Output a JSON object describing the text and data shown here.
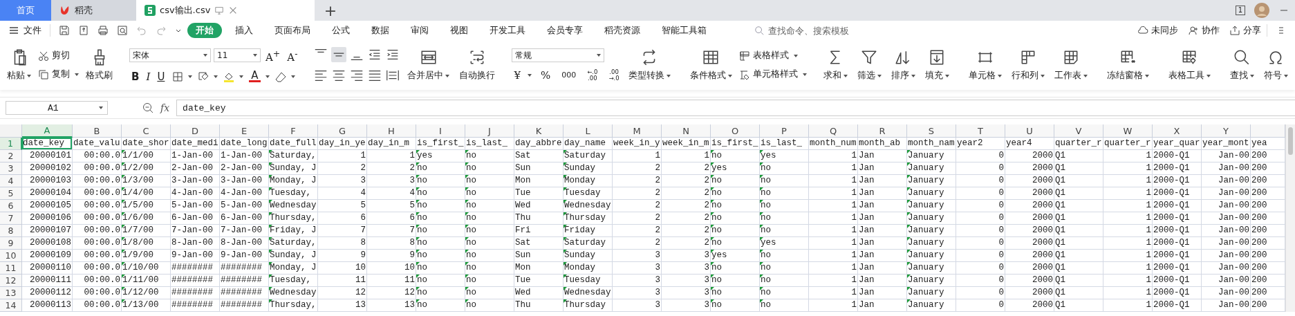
{
  "tabs": [
    {
      "label": "首页",
      "kind": "home",
      "selected": false
    },
    {
      "label": "稻壳",
      "kind": "docer",
      "selected": false
    },
    {
      "label": "csv输出.csv",
      "kind": "sheet",
      "selected": true
    }
  ],
  "new_tab": "+",
  "window_count": "1",
  "file_menu": "文件",
  "menu_tabs": [
    {
      "label": "开始",
      "selected": true
    },
    {
      "label": "插入",
      "selected": false
    },
    {
      "label": "页面布局",
      "selected": false
    },
    {
      "label": "公式",
      "selected": false
    },
    {
      "label": "数据",
      "selected": false
    },
    {
      "label": "审阅",
      "selected": false
    },
    {
      "label": "视图",
      "selected": false
    },
    {
      "label": "开发工具",
      "selected": false
    },
    {
      "label": "会员专享",
      "selected": false
    },
    {
      "label": "稻壳资源",
      "selected": false
    },
    {
      "label": "智能工具箱",
      "selected": false
    }
  ],
  "search": {
    "placeholder": "查找命令、搜索模板"
  },
  "actions": [
    "未同步",
    "协作",
    "分享"
  ],
  "ribbon": {
    "paste": {
      "label": "粘贴",
      "dropdown": true
    },
    "cut": {
      "label": "剪切",
      "dropdown": false
    },
    "copy": {
      "label": "复制",
      "dropdown": true
    },
    "format_painter": {
      "label": "格式刷",
      "dropdown": false
    },
    "font": {
      "name": "宋体",
      "size": "11",
      "grow": "A$^{+}$",
      "shrink": "A$^{-}$",
      "bold": "B",
      "italic": "I",
      "underline": "U",
      "font_color_label": "A"
    },
    "align_buttons": [
      {
        "selected": false
      },
      {
        "selected": true
      },
      {
        "selected": false
      },
      {
        "selected": false
      },
      {
        "selected": false
      },
      {
        "selected": false
      },
      {
        "selected": false
      },
      {
        "selected": false
      },
      {
        "selected": false
      },
      {
        "selected": false
      }
    ],
    "merge": {
      "label": "合并居中",
      "dropdown": true
    },
    "wrap": {
      "label": "自动换行",
      "dropdown": false
    },
    "number": {
      "format": "常规",
      "currency": "¥",
      "percent": "%",
      "thousands": "000",
      "increase_decimal": [
        "←.0",
        ".00"
      ],
      "decrease_decimal": [
        ".00",
        "→.0"
      ]
    },
    "convert": {
      "label": "类型转换",
      "dropdown": true
    },
    "conditional": {
      "label": "条件格式",
      "dropdown": true
    },
    "table_style": {
      "label": "表格样式",
      "dropdown": true
    },
    "cell_style": {
      "label": "单元格样式",
      "dropdown": true
    },
    "tool_groups": [
      [
        {
          "label": "求和",
          "dropdown": true
        },
        {
          "label": "筛选",
          "dropdown": true
        },
        {
          "label": "排序",
          "dropdown": true
        },
        {
          "label": "填充",
          "dropdown": true
        }
      ],
      [
        {
          "label": "单元格",
          "dropdown": true
        },
        {
          "label": "行和列",
          "dropdown": true
        },
        {
          "label": "工作表",
          "dropdown": true
        }
      ],
      [
        {
          "label": "冻结窗格",
          "dropdown": true
        }
      ],
      [
        {
          "label": "表格工具",
          "dropdown": true
        }
      ],
      [
        {
          "label": "查找",
          "dropdown": true
        },
        {
          "label": "符号",
          "dropdown": true
        }
      ]
    ]
  },
  "formula_bar": {
    "name_box": "A1",
    "fx": "fx",
    "formula": "date_key"
  },
  "grid": {
    "columns": [
      {
        "letter": "A",
        "numeric": true,
        "flagged": false,
        "selected": true
      },
      {
        "letter": "B",
        "numeric": true,
        "flagged": false,
        "selected": false
      },
      {
        "letter": "C",
        "numeric": false,
        "flagged": true,
        "selected": false
      },
      {
        "letter": "D",
        "numeric": false,
        "flagged": false,
        "selected": false
      },
      {
        "letter": "E",
        "numeric": false,
        "flagged": false,
        "selected": false
      },
      {
        "letter": "F",
        "numeric": false,
        "flagged": true,
        "selected": false
      },
      {
        "letter": "G",
        "numeric": true,
        "flagged": false,
        "selected": false
      },
      {
        "letter": "H",
        "numeric": true,
        "flagged": false,
        "selected": false
      },
      {
        "letter": "I",
        "numeric": false,
        "flagged": true,
        "selected": false
      },
      {
        "letter": "J",
        "numeric": false,
        "flagged": true,
        "selected": false
      },
      {
        "letter": "K",
        "numeric": false,
        "flagged": false,
        "selected": false
      },
      {
        "letter": "L",
        "numeric": false,
        "flagged": true,
        "selected": false
      },
      {
        "letter": "M",
        "numeric": true,
        "flagged": false,
        "selected": false
      },
      {
        "letter": "N",
        "numeric": true,
        "flagged": false,
        "selected": false
      },
      {
        "letter": "O",
        "numeric": false,
        "flagged": true,
        "selected": false
      },
      {
        "letter": "P",
        "numeric": false,
        "flagged": true,
        "selected": false
      },
      {
        "letter": "Q",
        "numeric": true,
        "flagged": false,
        "selected": false
      },
      {
        "letter": "R",
        "numeric": false,
        "flagged": false,
        "selected": false
      },
      {
        "letter": "S",
        "numeric": false,
        "flagged": true,
        "selected": false
      },
      {
        "letter": "T",
        "numeric": true,
        "flagged": false,
        "selected": false
      },
      {
        "letter": "U",
        "numeric": true,
        "flagged": false,
        "selected": false
      },
      {
        "letter": "V",
        "numeric": false,
        "flagged": false,
        "selected": false
      },
      {
        "letter": "W",
        "numeric": true,
        "flagged": false,
        "selected": false
      },
      {
        "letter": "X",
        "numeric": false,
        "flagged": false,
        "selected": false
      },
      {
        "letter": "Y",
        "numeric": true,
        "flagged": false,
        "selected": false
      },
      {
        "numeric": false,
        "flagged": false,
        "selected": false
      }
    ],
    "rows": [
      {
        "number": "1",
        "kind": "header",
        "selected": true,
        "cells": [
          "date_key",
          "date_valu",
          "date_shor",
          "date_medi",
          "date_long",
          "date_full",
          "day_in_ye",
          "day_in_m",
          "is_first_",
          "is_last_",
          "day_abbre",
          "day_name",
          "week_in_y",
          "week_in_m",
          "is_first_",
          "is_last_",
          "month_num",
          "month_ab",
          "month_nam",
          "year2",
          "year4",
          "quarter_r",
          "quarter_r",
          "year_quar",
          "year_mont",
          "yea"
        ]
      },
      {
        "number": "2",
        "kind": "data",
        "selected": false,
        "cells": [
          "20000101",
          "00:00.0",
          "1/1/00",
          "1-Jan-00",
          "1-Jan-00",
          "Saturday,",
          "1",
          "1",
          "yes",
          "no",
          "Sat",
          "Saturday",
          "1",
          "1",
          "no",
          "yes",
          "1",
          "Jan",
          "January",
          "0",
          "2000",
          "Q1",
          "1",
          "2000-Q1",
          "Jan-00",
          "200"
        ]
      },
      {
        "number": "3",
        "kind": "data",
        "selected": false,
        "cells": [
          "20000102",
          "00:00.0",
          "1/2/00",
          "2-Jan-00",
          "2-Jan-00",
          "Sunday, J",
          "2",
          "2",
          "no",
          "no",
          "Sun",
          "Sunday",
          "2",
          "2",
          "yes",
          "no",
          "1",
          "Jan",
          "January",
          "0",
          "2000",
          "Q1",
          "1",
          "2000-Q1",
          "Jan-00",
          "200"
        ]
      },
      {
        "number": "4",
        "kind": "data",
        "selected": false,
        "cells": [
          "20000103",
          "00:00.0",
          "1/3/00",
          "3-Jan-00",
          "3-Jan-00",
          "Monday, J",
          "3",
          "3",
          "no",
          "no",
          "Mon",
          "Monday",
          "2",
          "2",
          "no",
          "no",
          "1",
          "Jan",
          "January",
          "0",
          "2000",
          "Q1",
          "1",
          "2000-Q1",
          "Jan-00",
          "200"
        ]
      },
      {
        "number": "5",
        "kind": "data",
        "selected": false,
        "cells": [
          "20000104",
          "00:00.0",
          "1/4/00",
          "4-Jan-00",
          "4-Jan-00",
          "Tuesday,",
          "4",
          "4",
          "no",
          "no",
          "Tue",
          "Tuesday",
          "2",
          "2",
          "no",
          "no",
          "1",
          "Jan",
          "January",
          "0",
          "2000",
          "Q1",
          "1",
          "2000-Q1",
          "Jan-00",
          "200"
        ]
      },
      {
        "number": "6",
        "kind": "data",
        "selected": false,
        "cells": [
          "20000105",
          "00:00.0",
          "1/5/00",
          "5-Jan-00",
          "5-Jan-00",
          "Wednesday",
          "5",
          "5",
          "no",
          "no",
          "Wed",
          "Wednesday",
          "2",
          "2",
          "no",
          "no",
          "1",
          "Jan",
          "January",
          "0",
          "2000",
          "Q1",
          "1",
          "2000-Q1",
          "Jan-00",
          "200"
        ]
      },
      {
        "number": "7",
        "kind": "data",
        "selected": false,
        "cells": [
          "20000106",
          "00:00.0",
          "1/6/00",
          "6-Jan-00",
          "6-Jan-00",
          "Thursday,",
          "6",
          "6",
          "no",
          "no",
          "Thu",
          "Thursday",
          "2",
          "2",
          "no",
          "no",
          "1",
          "Jan",
          "January",
          "0",
          "2000",
          "Q1",
          "1",
          "2000-Q1",
          "Jan-00",
          "200"
        ]
      },
      {
        "number": "8",
        "kind": "data",
        "selected": false,
        "cells": [
          "20000107",
          "00:00.0",
          "1/7/00",
          "7-Jan-00",
          "7-Jan-00",
          "Friday, J",
          "7",
          "7",
          "no",
          "no",
          "Fri",
          "Friday",
          "2",
          "2",
          "no",
          "no",
          "1",
          "Jan",
          "January",
          "0",
          "2000",
          "Q1",
          "1",
          "2000-Q1",
          "Jan-00",
          "200"
        ]
      },
      {
        "number": "9",
        "kind": "data",
        "selected": false,
        "cells": [
          "20000108",
          "00:00.0",
          "1/8/00",
          "8-Jan-00",
          "8-Jan-00",
          "Saturday,",
          "8",
          "8",
          "no",
          "no",
          "Sat",
          "Saturday",
          "2",
          "2",
          "no",
          "yes",
          "1",
          "Jan",
          "January",
          "0",
          "2000",
          "Q1",
          "1",
          "2000-Q1",
          "Jan-00",
          "200"
        ]
      },
      {
        "number": "10",
        "kind": "data",
        "selected": false,
        "cells": [
          "20000109",
          "00:00.0",
          "1/9/00",
          "9-Jan-00",
          "9-Jan-00",
          "Sunday, J",
          "9",
          "9",
          "no",
          "no",
          "Sun",
          "Sunday",
          "3",
          "3",
          "yes",
          "no",
          "1",
          "Jan",
          "January",
          "0",
          "2000",
          "Q1",
          "1",
          "2000-Q1",
          "Jan-00",
          "200"
        ]
      },
      {
        "number": "11",
        "kind": "data",
        "selected": false,
        "cells": [
          "20000110",
          "00:00.0",
          "1/10/00",
          "########",
          "########",
          "Monday, J",
          "10",
          "10",
          "no",
          "no",
          "Mon",
          "Monday",
          "3",
          "3",
          "no",
          "no",
          "1",
          "Jan",
          "January",
          "0",
          "2000",
          "Q1",
          "1",
          "2000-Q1",
          "Jan-00",
          "200"
        ]
      },
      {
        "number": "12",
        "kind": "data",
        "selected": false,
        "cells": [
          "20000111",
          "00:00.0",
          "1/11/00",
          "########",
          "########",
          "Tuesday,",
          "11",
          "11",
          "no",
          "no",
          "Tue",
          "Tuesday",
          "3",
          "3",
          "no",
          "no",
          "1",
          "Jan",
          "January",
          "0",
          "2000",
          "Q1",
          "1",
          "2000-Q1",
          "Jan-00",
          "200"
        ]
      },
      {
        "number": "13",
        "kind": "data",
        "selected": false,
        "cells": [
          "20000112",
          "00:00.0",
          "1/12/00",
          "########",
          "########",
          "Wednesday",
          "12",
          "12",
          "no",
          "no",
          "Wed",
          "Wednesday",
          "3",
          "3",
          "no",
          "no",
          "1",
          "Jan",
          "January",
          "0",
          "2000",
          "Q1",
          "1",
          "2000-Q1",
          "Jan-00",
          "200"
        ]
      },
      {
        "number": "14",
        "kind": "data",
        "selected": false,
        "cells": [
          "20000113",
          "00:00.0",
          "1/13/00",
          "########",
          "########",
          "Thursday,",
          "13",
          "13",
          "no",
          "no",
          "Thu",
          "Thursday",
          "3",
          "3",
          "no",
          "no",
          "1",
          "Jan",
          "January",
          "0",
          "2000",
          "Q1",
          "1",
          "2000-Q1",
          "Jan-00",
          "200"
        ]
      }
    ]
  }
}
